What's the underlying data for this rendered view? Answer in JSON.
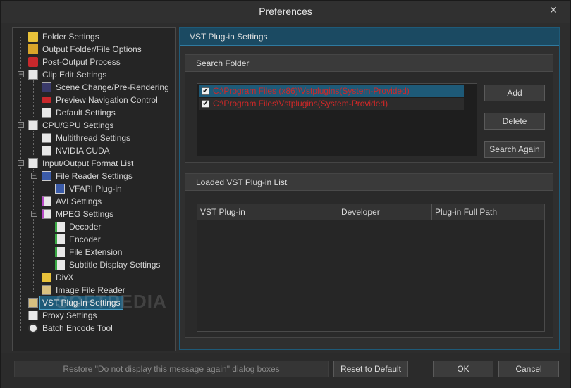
{
  "window": {
    "title": "Preferences",
    "close_glyph": "✕"
  },
  "tree": {
    "items": [
      {
        "label": "Folder Settings",
        "icon": "folder-icon"
      },
      {
        "label": "Output Folder/File Options",
        "icon": "folder-icon"
      },
      {
        "label": "Post-Output Process",
        "icon": "red-stop-icon"
      },
      {
        "label": "Clip Edit Settings",
        "icon": "document-icon"
      },
      {
        "label": "Scene Change/Pre-Rendering",
        "icon": "film-icon"
      },
      {
        "label": "Preview Navigation Control",
        "icon": "red-arrows-icon"
      },
      {
        "label": "Default Settings",
        "icon": "document-icon"
      },
      {
        "label": "CPU/GPU Settings",
        "icon": "document-icon"
      },
      {
        "label": "Multithread Settings",
        "icon": "document-icon"
      },
      {
        "label": "NVIDIA CUDA",
        "icon": "document-icon"
      },
      {
        "label": "Input/Output Format List",
        "icon": "list-icon"
      },
      {
        "label": "File Reader Settings",
        "icon": "monitor-icon"
      },
      {
        "label": "VFAPI Plug-in",
        "icon": "monitor-icon"
      },
      {
        "label": "AVI Settings",
        "icon": "document-icon"
      },
      {
        "label": "MPEG Settings",
        "icon": "document-icon"
      },
      {
        "label": "Decoder",
        "icon": "green-document-icon"
      },
      {
        "label": "Encoder",
        "icon": "green-document-icon"
      },
      {
        "label": "File Extension",
        "icon": "green-document-icon"
      },
      {
        "label": "Subtitle Display Settings",
        "icon": "green-document-icon"
      },
      {
        "label": "DivX",
        "icon": "folder-icon"
      },
      {
        "label": "Image File Reader",
        "icon": "image-icon"
      },
      {
        "label": "VST Plug-in Settings",
        "icon": "plugin-icon"
      },
      {
        "label": "Proxy Settings",
        "icon": "copy-icon"
      },
      {
        "label": "Batch Encode Tool",
        "icon": "clock-icon"
      }
    ],
    "expander_minus": "−"
  },
  "panel": {
    "title": "VST Plug-in Settings",
    "search_folder": {
      "title": "Search Folder",
      "folders": [
        {
          "path": "C:\\Program Files (x86)\\Vstplugins(System-Provided)",
          "checked": true,
          "selected": true
        },
        {
          "path": "C:\\Program Files\\Vstplugins(System-Provided)",
          "checked": true,
          "selected": false
        }
      ],
      "check_glyph": "✔",
      "add_label": "Add",
      "delete_label": "Delete",
      "search_again_label": "Search Again"
    },
    "loaded_list": {
      "title": "Loaded VST Plug-in List",
      "columns": [
        "VST Plug-in",
        "Developer",
        "Plug-in Full Path"
      ]
    }
  },
  "footer": {
    "restore_label": "Restore \"Do not display this message again\" dialog boxes",
    "reset_label": "Reset to Default",
    "ok_label": "OK",
    "cancel_label": "Cancel"
  },
  "watermark": "SOFTPEDIA"
}
